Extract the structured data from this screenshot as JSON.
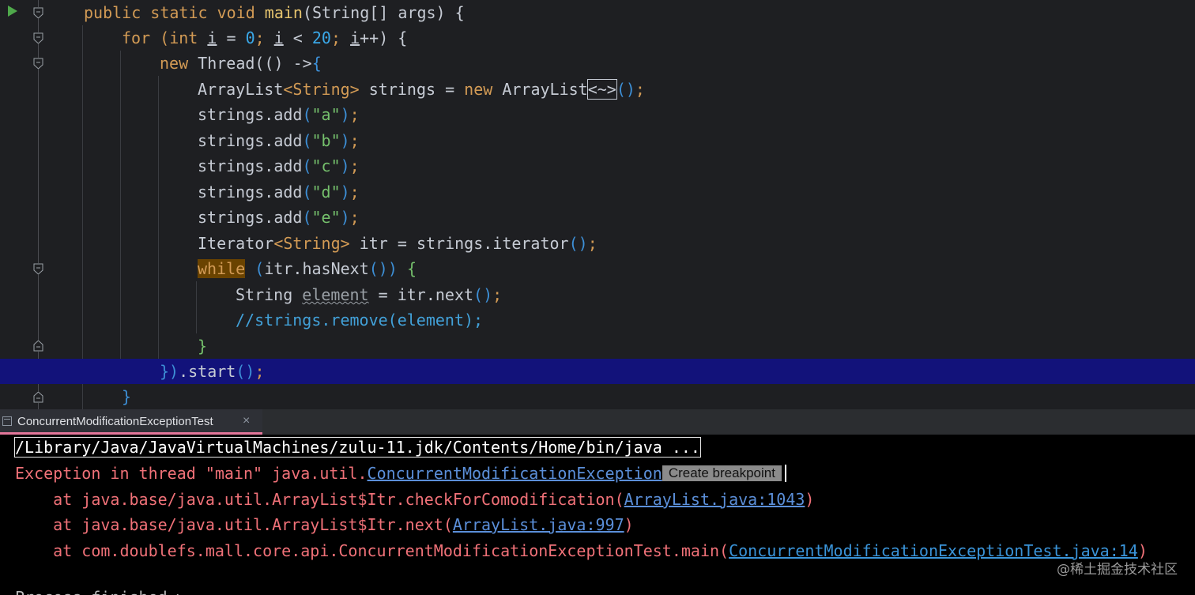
{
  "editor": {
    "lines": [
      {
        "parts": [
          "public static void ",
          "main",
          "(String[] args) {"
        ]
      },
      {
        "parts": [
          "for (",
          "int ",
          "i",
          " = ",
          "0",
          "; ",
          "i",
          " < ",
          "20",
          "; ",
          "i",
          "++) {"
        ]
      },
      {
        "parts": [
          "new ",
          "Thread",
          "(",
          "() ->",
          "{"
        ]
      },
      {
        "parts": [
          "ArrayList",
          "<String>",
          " strings = ",
          "new ",
          "ArrayList",
          "<~>",
          "()",
          ";"
        ]
      },
      {
        "call": "strings.add",
        "arg": "\"a\""
      },
      {
        "call": "strings.add",
        "arg": "\"b\""
      },
      {
        "call": "strings.add",
        "arg": "\"c\""
      },
      {
        "call": "strings.add",
        "arg": "\"d\""
      },
      {
        "call": "strings.add",
        "arg": "\"e\""
      },
      {
        "parts": [
          "Iterator",
          "<String>",
          " itr = strings.iterator",
          "()",
          ";"
        ]
      },
      {
        "parts": [
          "while",
          " ",
          "(",
          "itr.hasNext",
          "()",
          ")",
          " {"
        ]
      },
      {
        "parts": [
          "String ",
          "element",
          " = itr.next",
          "()",
          ";"
        ]
      },
      {
        "text": "//strings.remove(element);"
      },
      {
        "text": "}"
      },
      {
        "parts": [
          "})",
          ".start",
          "()",
          ";"
        ]
      },
      {
        "text": "}"
      }
    ]
  },
  "run_tab": {
    "label": "ConcurrentModificationExceptionTest",
    "close": "×"
  },
  "console": {
    "command": "/Library/Java/JavaVirtualMachines/zulu-11.jdk/Contents/Home/bin/java ...",
    "exception_prefix": "Exception in thread \"main\" java.util.",
    "exception_class": "ConcurrentModificationException",
    "breakpoint_button": "Create breakpoint",
    "stack": [
      {
        "prefix": "    at java.base/java.util.ArrayList$Itr.checkForComodification(",
        "link": "ArrayList.java:1043",
        "suffix": ")"
      },
      {
        "prefix": "    at java.base/java.util.ArrayList$Itr.next(",
        "link": "ArrayList.java:997",
        "suffix": ")"
      },
      {
        "prefix": "    at com.doublefs.mall.core.api.ConcurrentModificationExceptionTest.main(",
        "link": "ConcurrentModificationExceptionTest.java:14",
        "suffix": ")"
      }
    ],
    "cut_line": "Process finished with"
  },
  "watermark": "@稀土掘金技术社区",
  "colors": {
    "editor_bg": "#1e1f22",
    "keyword": "#d39b55",
    "number": "#3aa8e8",
    "string": "#75c06c",
    "error": "#f07178",
    "current_line": "#12127a"
  }
}
